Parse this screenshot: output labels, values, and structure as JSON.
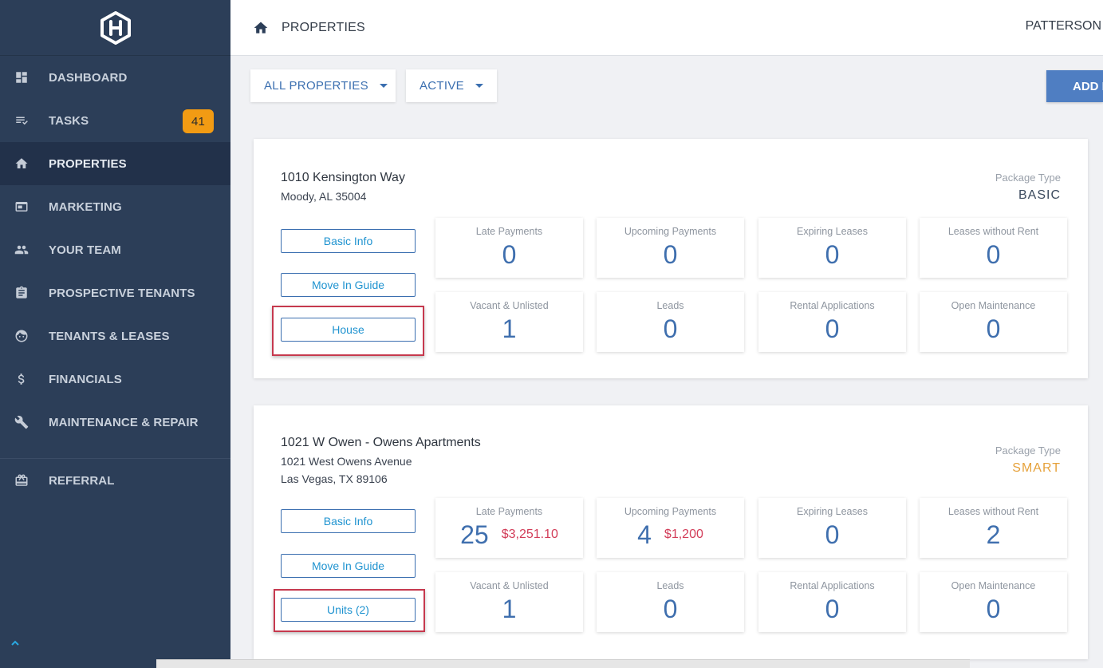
{
  "sidebar": {
    "items": [
      {
        "label": "DASHBOARD",
        "icon": "dashboard-icon"
      },
      {
        "label": "TASKS",
        "icon": "tasks-icon",
        "badge": "41"
      },
      {
        "label": "PROPERTIES",
        "icon": "home-icon",
        "active": true
      },
      {
        "label": "MARKETING",
        "icon": "marketing-icon"
      },
      {
        "label": "YOUR TEAM",
        "icon": "team-icon"
      },
      {
        "label": "PROSPECTIVE TENANTS",
        "icon": "clipboard-icon"
      },
      {
        "label": "TENANTS & LEASES",
        "icon": "face-icon"
      },
      {
        "label": "FINANCIALS",
        "icon": "dollar-icon"
      },
      {
        "label": "MAINTENANCE & REPAIR",
        "icon": "wrench-icon"
      },
      {
        "label": "REFERRAL",
        "icon": "gift-icon"
      }
    ]
  },
  "topbar": {
    "title": "PROPERTIES",
    "user": "PATTERSON"
  },
  "filters": {
    "properties": "ALL PROPERTIES",
    "status": "ACTIVE",
    "add_label": "ADD P"
  },
  "properties": [
    {
      "title": "1010 Kensington Way",
      "address_lines": [
        "Moody, AL 35004"
      ],
      "package_label": "Package Type",
      "package_type": "BASIC",
      "package_color": "#3b4a5e",
      "buttons": [
        "Basic Info",
        "Move In Guide",
        "House"
      ],
      "stats": [
        {
          "label": "Late Payments",
          "value": "0",
          "money": ""
        },
        {
          "label": "Upcoming Payments",
          "value": "0",
          "money": ""
        },
        {
          "label": "Expiring Leases",
          "value": "0",
          "money": ""
        },
        {
          "label": "Leases without Rent",
          "value": "0",
          "money": ""
        },
        {
          "label": "Vacant & Unlisted",
          "value": "1",
          "money": ""
        },
        {
          "label": "Leads",
          "value": "0",
          "money": ""
        },
        {
          "label": "Rental Applications",
          "value": "0",
          "money": ""
        },
        {
          "label": "Open Maintenance",
          "value": "0",
          "money": ""
        }
      ]
    },
    {
      "title": "1021 W Owen - Owens Apartments",
      "address_lines": [
        "1021 West Owens Avenue",
        "Las Vegas, TX 89106"
      ],
      "package_label": "Package Type",
      "package_type": "SMART",
      "package_color": "#e6a23c",
      "buttons": [
        "Basic Info",
        "Move In Guide",
        "Units (2)"
      ],
      "stats": [
        {
          "label": "Late Payments",
          "value": "25",
          "money": "$3,251.10"
        },
        {
          "label": "Upcoming Payments",
          "value": "4",
          "money": "$1,200"
        },
        {
          "label": "Expiring Leases",
          "value": "0",
          "money": ""
        },
        {
          "label": "Leases without Rent",
          "value": "2",
          "money": ""
        },
        {
          "label": "Vacant & Unlisted",
          "value": "1",
          "money": ""
        },
        {
          "label": "Leads",
          "value": "0",
          "money": ""
        },
        {
          "label": "Rental Applications",
          "value": "0",
          "money": ""
        },
        {
          "label": "Open Maintenance",
          "value": "0",
          "money": ""
        }
      ]
    }
  ]
}
